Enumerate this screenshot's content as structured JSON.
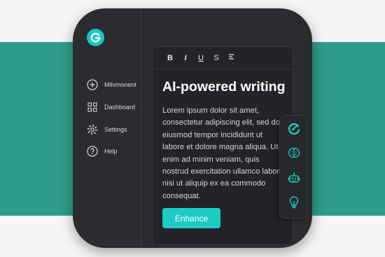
{
  "colors": {
    "band": "#2e9c8b",
    "panel": "#2b2c2f",
    "accent": "#1dcbc4",
    "text": "#d4d5d7"
  },
  "brand": {
    "logo_letter": "G",
    "logo_icon": "grammar-logo-icon"
  },
  "sidebar": {
    "items": [
      {
        "label": "Milvmonent",
        "icon": "plus-circle-icon"
      },
      {
        "label": "Dashboard",
        "icon": "grid-icon"
      },
      {
        "label": "Settings",
        "icon": "gear-icon"
      },
      {
        "label": "Help",
        "icon": "question-circle-icon"
      }
    ]
  },
  "toolbar": {
    "bold": "B",
    "italic": "I",
    "underline": "U",
    "strike": "S",
    "list_icon": "list-icon"
  },
  "editor": {
    "heading": "AI-powered writing",
    "body": "Lorem ipsum dolor sit amet, consectetur adipiscing elit, sed do eiusmod tempor incididunt ut labore et dolore magna aliqua. Ut enim ad minim veniam, quis nostrud exercitation ullamco laboris nisi ut aliquip ex ea commodo consequat.",
    "button": "Enhance"
  },
  "floating_tools": [
    {
      "icon": "grammar-check-icon"
    },
    {
      "icon": "brain-icon"
    },
    {
      "icon": "robot-icon"
    },
    {
      "icon": "lightbulb-icon"
    }
  ]
}
